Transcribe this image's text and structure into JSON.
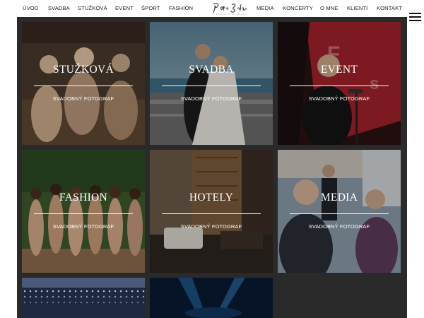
{
  "nav": {
    "left": [
      "ÚVOD",
      "SVADBA",
      "STUŽKOVÁ",
      "EVENT",
      "ŠPORT",
      "FASHION"
    ],
    "right": [
      "MEDIA",
      "KONCERTY",
      "O MNE",
      "KLIENTI",
      "KONTAKT"
    ],
    "logo_text": "Peter Sekár"
  },
  "gallery": {
    "tiles": [
      {
        "title": "STUŽKOVÁ",
        "subtitle": "SVADOBNÝ FOTOGRAF"
      },
      {
        "title": "SVADBA",
        "subtitle": "SVADOBNÝ FOTOGRAF"
      },
      {
        "title": "EVENT",
        "subtitle": "SVADOBNÝ FOTOGRAF"
      },
      {
        "title": "FASHION",
        "subtitle": "SVADOBNÝ FOTOGRAF"
      },
      {
        "title": "HOTELY",
        "subtitle": "SVADOBNÝ FOTOGRAF"
      },
      {
        "title": "MEDIA",
        "subtitle": "SVADOBNÝ FOTOGRAF"
      }
    ]
  },
  "colors": {
    "gallery_bg": "#2a2a2a",
    "text_on_photo": "#ffffff",
    "nav_text": "#222222"
  },
  "icons": [
    "menu-icon"
  ]
}
